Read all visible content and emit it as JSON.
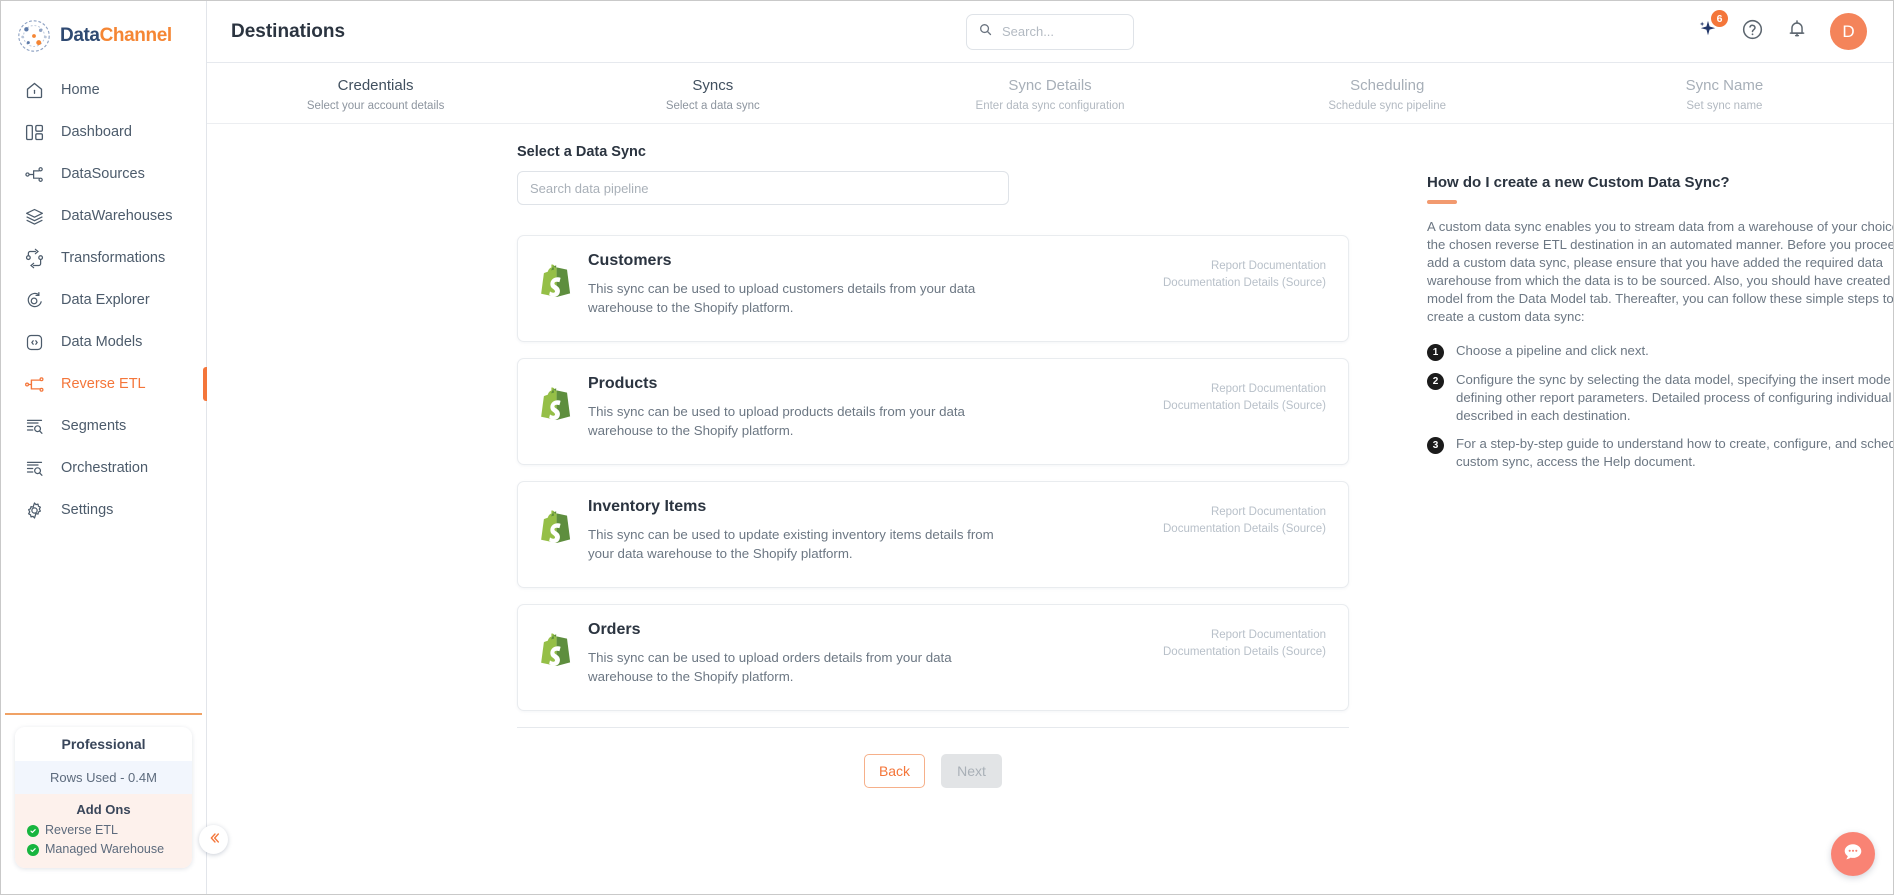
{
  "brand": {
    "name_part1": "Data",
    "name_part2": "Channel",
    "logo_icon": "datachannel-globe-logo-icon"
  },
  "sidebar": {
    "items": [
      {
        "label": "Home",
        "icon": "home-icon",
        "active": false
      },
      {
        "label": "Dashboard",
        "icon": "dashboard-icon",
        "active": false
      },
      {
        "label": "DataSources",
        "icon": "datasources-icon",
        "active": false
      },
      {
        "label": "DataWarehouses",
        "icon": "datawarehouses-icon",
        "active": false
      },
      {
        "label": "Transformations",
        "icon": "transformations-icon",
        "active": false
      },
      {
        "label": "Data Explorer",
        "icon": "data-explorer-icon",
        "active": false
      },
      {
        "label": "Data Models",
        "icon": "data-models-icon",
        "active": false
      },
      {
        "label": "Reverse ETL",
        "icon": "reverse-etl-icon",
        "active": true
      },
      {
        "label": "Segments",
        "icon": "segments-icon",
        "active": false
      },
      {
        "label": "Orchestration",
        "icon": "orchestration-icon",
        "active": false
      },
      {
        "label": "Settings",
        "icon": "gear-icon",
        "active": false
      }
    ],
    "plan": {
      "tier": "Professional",
      "rows_used": "Rows Used - 0.4M",
      "addons_heading": "Add Ons",
      "addons": [
        "Reverse ETL",
        "Managed Warehouse"
      ]
    },
    "collapse_icon": "chevron-double-left-icon"
  },
  "topbar": {
    "title": "Destinations",
    "search": {
      "placeholder": "Search...",
      "value": "",
      "icon": "search-icon"
    },
    "ai_icon": "sparkle-ai-icon",
    "ai_badge": "6",
    "help_icon": "help-circle-icon",
    "notification_icon": "bell-icon",
    "avatar_initial": "D"
  },
  "stepper": [
    {
      "title": "Credentials",
      "subtitle": "Select your account details",
      "state": "done"
    },
    {
      "title": "Syncs",
      "subtitle": "Select a data sync",
      "state": "active"
    },
    {
      "title": "Sync Details",
      "subtitle": "Enter data sync configuration",
      "state": "inactive"
    },
    {
      "title": "Scheduling",
      "subtitle": "Schedule sync pipeline",
      "state": "inactive"
    },
    {
      "title": "Sync Name",
      "subtitle": "Set sync name",
      "state": "inactive"
    }
  ],
  "main": {
    "section_label": "Select a Data Sync",
    "pipeline_search": {
      "placeholder": "Search data pipeline",
      "value": ""
    },
    "cards": [
      {
        "icon": "shopify-icon",
        "title": "Customers",
        "description": "This sync can be used to upload customers details from your data warehouse to the Shopify platform.",
        "link_primary": "Report Documentation",
        "link_secondary": "Documentation Details (Source)"
      },
      {
        "icon": "shopify-icon",
        "title": "Products",
        "description": "This sync can be used to upload products details from your data warehouse to the Shopify platform.",
        "link_primary": "Report Documentation",
        "link_secondary": "Documentation Details (Source)"
      },
      {
        "icon": "shopify-icon",
        "title": "Inventory Items",
        "description": "This sync can be used to update existing inventory items details from your data warehouse to the Shopify platform.",
        "link_primary": "Report Documentation",
        "link_secondary": "Documentation Details (Source)"
      },
      {
        "icon": "shopify-icon",
        "title": "Orders",
        "description": "This sync can be used to upload orders details from your data warehouse to the Shopify platform.",
        "link_primary": "Report Documentation",
        "link_secondary": "Documentation Details (Source)"
      }
    ],
    "back_button": "Back",
    "next_button": "Next"
  },
  "help": {
    "title": "How do I create a new Custom Data Sync?",
    "paragraph": "A custom data sync enables you to stream data from a warehouse of your choice to the chosen reverse ETL destination in an automated manner. Before you proceed to add a custom data sync, please ensure that you have added the required data warehouse from which the data is to be sourced. Also, you should have created a data model from the Data Model tab. Thereafter, you can follow these simple steps to create a custom data sync:",
    "steps": [
      {
        "num": "1",
        "text": "Choose a pipeline and click next."
      },
      {
        "num": "2",
        "text": "Configure the sync by selecting the data model, specifying the insert mode and defining other report parameters. Detailed process of configuring individual syncs is described in each destination."
      },
      {
        "num": "3",
        "text": "For a step-by-step guide to understand how to create, configure, and schedule a custom sync, access the Help document."
      }
    ]
  },
  "chat": {
    "icon": "chat-bubble-icon"
  },
  "colors": {
    "accent_orange": "#f4763a",
    "brand_navy": "#2f4a72",
    "avatar_bg": "#f4845a",
    "shopify_green": "#5fab45",
    "chat_fab": "#f98374"
  }
}
